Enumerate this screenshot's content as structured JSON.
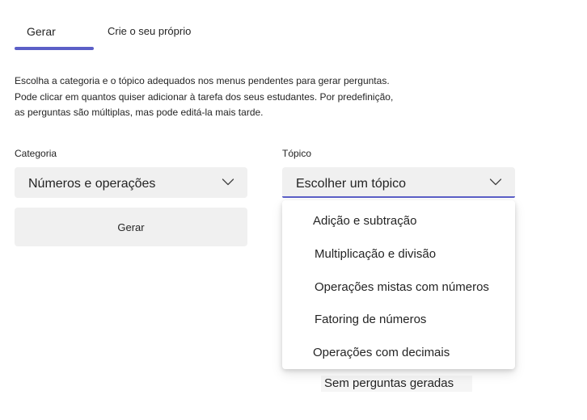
{
  "tabs": [
    {
      "label": "Gerar",
      "active": true
    },
    {
      "label": "Crie o seu próprio",
      "active": false
    }
  ],
  "accent_color": "#5b5fc7",
  "description": [
    "Escolha a categoria e o tópico adequados nos menus pendentes para gerar perguntas.",
    "Pode clicar em quantos quiser adicionar à tarefa dos seus estudantes. Por predefinição,",
    "as perguntas são múltiplas, mas pode editá-la mais tarde."
  ],
  "category": {
    "label": "Categoria",
    "value": "Números e operações",
    "icon": "chevron-down-icon"
  },
  "topic": {
    "label": "Tópico",
    "placeholder": "Escolher um tópico",
    "icon": "chevron-down-icon",
    "options": [
      "Adição e subtração",
      "Multiplicação e divisão",
      "Operações mistas com números",
      "Fatoring de números",
      "Operações com decimais"
    ]
  },
  "generate_button": "Gerar",
  "empty_state": "Sem perguntas geradas"
}
